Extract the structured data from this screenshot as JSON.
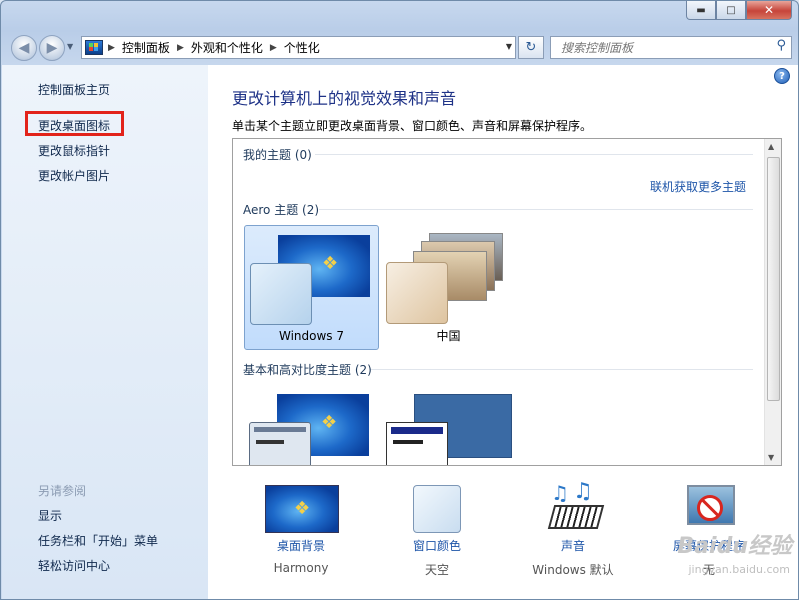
{
  "window": {
    "caption_buttons": {
      "minimize": "▬",
      "maximize": "□",
      "close": "✕"
    }
  },
  "nav": {
    "back_icon": "back-arrow-icon",
    "forward_icon": "forward-arrow-icon",
    "breadcrumbs": [
      "控制面板",
      "外观和个性化",
      "个性化"
    ],
    "search_placeholder": "搜索控制面板"
  },
  "sidebar": {
    "home": "控制面板主页",
    "tasks": [
      "更改桌面图标",
      "更改鼠标指针",
      "更改帐户图片"
    ],
    "see_also_title": "另请参阅",
    "see_also": [
      "显示",
      "任务栏和「开始」菜单",
      "轻松访问中心"
    ]
  },
  "main": {
    "title": "更改计算机上的视觉效果和声音",
    "subtitle": "单击某个主题立即更改桌面背景、窗口颜色、声音和屏幕保护程序。",
    "my_themes": "我的主题 (0)",
    "online_link": "联机获取更多主题",
    "aero_header": "Aero 主题 (2)",
    "aero_themes": [
      "Windows 7",
      "中国"
    ],
    "basic_header": "基本和高对比度主题 (2)"
  },
  "bottom": {
    "items": [
      {
        "label": "桌面背景",
        "value": "Harmony"
      },
      {
        "label": "窗口颜色",
        "value": "天空"
      },
      {
        "label": "声音",
        "value": "Windows 默认"
      },
      {
        "label": "屏幕保护程序",
        "value": "无"
      }
    ]
  },
  "watermark": {
    "logo": "Baidu经验",
    "url": "jingyan.baidu.com"
  },
  "colors": {
    "accent": "#1e55a8",
    "highlight": "#e2231a",
    "title": "#1e3287"
  }
}
